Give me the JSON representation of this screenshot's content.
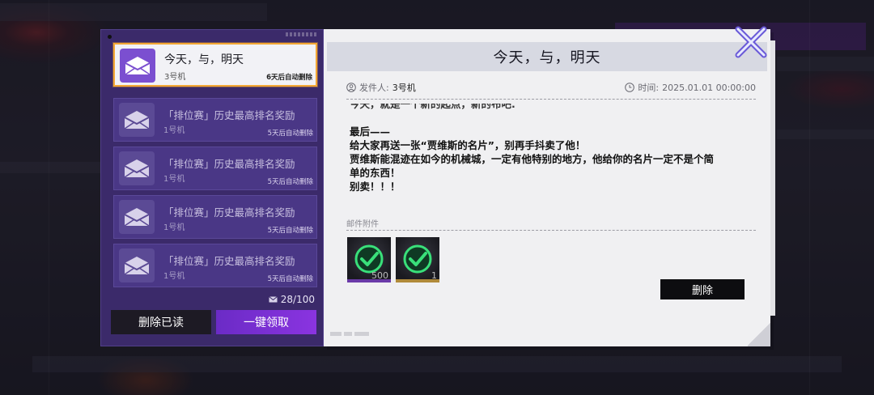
{
  "left_panel": {
    "mails": [
      {
        "title": "今天，与，明天",
        "sender": "3号机",
        "expire": "6天后自动删除",
        "active": true
      },
      {
        "title": "「排位赛」历史最高排名奖励",
        "sender": "1号机",
        "expire": "5天后自动删除",
        "active": false
      },
      {
        "title": "「排位赛」历史最高排名奖励",
        "sender": "1号机",
        "expire": "5天后自动删除",
        "active": false
      },
      {
        "title": "「排位赛」历史最高排名奖励",
        "sender": "1号机",
        "expire": "5天后自动删除",
        "active": false
      },
      {
        "title": "「排位赛」历史最高排名奖励",
        "sender": "1号机",
        "expire": "5天后自动删除",
        "active": false
      }
    ],
    "mail_count": "28/100",
    "delete_read_label": "删除已读",
    "claim_all_label": "一键领取"
  },
  "detail": {
    "title": "今天，与，明天",
    "sender_label": "发件人:",
    "sender_value": "3号机",
    "time_label": "时间:",
    "time_value": "2025.01.01 00:00:00",
    "body_partial_top": "今天，就是一个新的起点，新的布吧.",
    "body": "最后——\n给大家再送一张“贾维斯的名片”，别再手抖卖了他！\n贾维斯能混迹在如今的机械城，一定有他特别的地方，他给你的名片一定不是个简\n单的东西！\n别卖！！！",
    "attachments_label": "邮件附件",
    "attachments": [
      {
        "qty": "500",
        "icon": "check-circle-icon",
        "rarity": "purple"
      },
      {
        "qty": "1",
        "icon": "check-circle-icon",
        "rarity": "gold"
      }
    ],
    "delete_label": "删除"
  },
  "colors": {
    "accent_purple": "#7b4fd0",
    "selection_border": "#f4a734",
    "check_green": "#39e07a"
  }
}
